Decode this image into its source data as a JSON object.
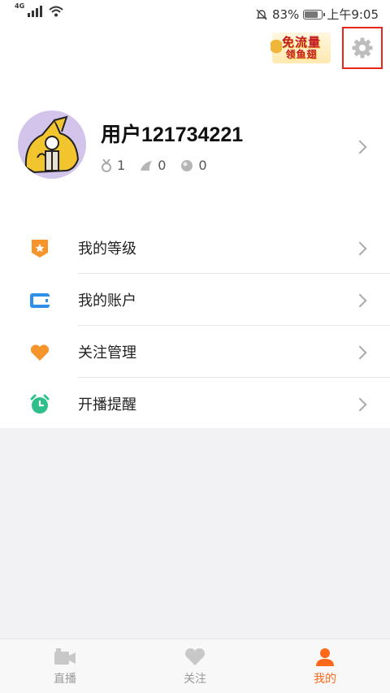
{
  "status_bar": {
    "network": "4G",
    "battery_percent": "83%",
    "battery_level": 0.83,
    "time": "上午9:05"
  },
  "promo_banner": {
    "line1": "免流量",
    "line2": "领鱼翅"
  },
  "profile": {
    "username": "用户121734221",
    "stats": [
      {
        "icon": "medal-icon",
        "value": "1"
      },
      {
        "icon": "fin-icon",
        "value": "0"
      },
      {
        "icon": "pearl-icon",
        "value": "0"
      }
    ]
  },
  "menu": [
    {
      "label": "我的等级",
      "icon": "level-badge-icon",
      "color": "#f5952b"
    },
    {
      "label": "我的账户",
      "icon": "wallet-icon",
      "color": "#2e8fe8"
    },
    {
      "label": "关注管理",
      "icon": "heart-icon",
      "color": "#f5952b"
    },
    {
      "label": "开播提醒",
      "icon": "alarm-clock-icon",
      "color": "#2fbf8a"
    }
  ],
  "bottom_nav": [
    {
      "label": "直播",
      "icon": "live-camera-icon"
    },
    {
      "label": "关注",
      "icon": "heart-icon"
    },
    {
      "label": "我的",
      "icon": "person-icon",
      "active": true
    }
  ],
  "colors": {
    "accent": "#ff6a1a",
    "highlight_box": "#e8261c",
    "inactive_icon": "#c8c8c8"
  }
}
